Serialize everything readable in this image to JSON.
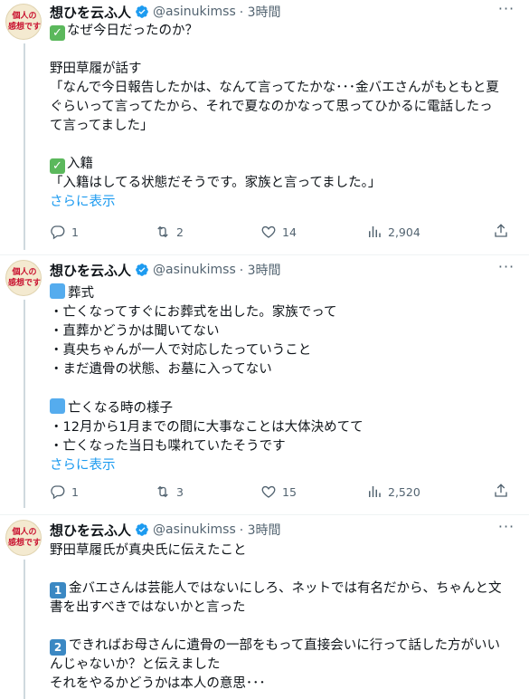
{
  "tweets": [
    {
      "avatar_text": [
        "個人の",
        "感想です"
      ],
      "name": "想ひを云ふ人",
      "handle": "@asinukimss",
      "time": "· 3時間",
      "lines": [
        {
          "prefix": "check",
          "text": "なぜ今日だったのか？"
        },
        {
          "text": ""
        },
        {
          "text": "野田草履が話す"
        },
        {
          "text": "「なんで今日報告したかは、なんて言ってたかな･･･金バエさんがもともと夏"
        },
        {
          "text": "ぐらいって言ってたから、それで夏なのかなって思ってひかるに電話したっ"
        },
        {
          "text": "て言ってました」"
        },
        {
          "text": ""
        },
        {
          "prefix": "check",
          "text": "入籍"
        },
        {
          "text": "「入籍はしてる状態だそうです。家族と言ってました。」"
        }
      ],
      "show_more": "さらに表示",
      "replies": "1",
      "retweets": "2",
      "likes": "14",
      "views": "2,904"
    },
    {
      "avatar_text": [
        "個人の",
        "感想です"
      ],
      "name": "想ひを云ふ人",
      "handle": "@asinukimss",
      "time": "· 3時間",
      "lines": [
        {
          "prefix": "blue",
          "text": "葬式"
        },
        {
          "text": "・亡くなってすぐにお葬式を出した。家族でって"
        },
        {
          "text": "・直葬かどうかは聞いてない"
        },
        {
          "text": "・真央ちゃんが一人で対応したっていうこと"
        },
        {
          "text": "・まだ遺骨の状態、お墓に入ってない"
        },
        {
          "text": ""
        },
        {
          "prefix": "blue",
          "text": "亡くなる時の様子"
        },
        {
          "text": "・12月から1月までの間に大事なことは大体決めてて"
        },
        {
          "text": "・亡くなった当日も喋れていたそうです"
        }
      ],
      "show_more": "さらに表示",
      "replies": "1",
      "retweets": "3",
      "likes": "15",
      "views": "2,520"
    },
    {
      "avatar_text": [
        "個人の",
        "感想です"
      ],
      "name": "想ひを云ふ人",
      "handle": "@asinukimss",
      "time": "· 3時間",
      "lines": [
        {
          "text": "野田草履氏が真央氏に伝えたこと"
        },
        {
          "text": ""
        },
        {
          "prefix": "1",
          "text": "金バエさんは芸能人ではないにしろ、ネットでは有名だから、ちゃんと文"
        },
        {
          "text": "書を出すべきではないかと言った"
        },
        {
          "text": ""
        },
        {
          "prefix": "2",
          "text": "できればお母さんに遺骨の一部をもって直接会いに行って話した方がいい"
        },
        {
          "text": "んじゃないか？と伝えました"
        },
        {
          "text": "それをやるかどうかは本人の意思･･･"
        }
      ]
    }
  ],
  "colors": {
    "accent": "#1d9bf0",
    "muted": "#536471",
    "verified": "#1d9bf0",
    "check_green": "#5bb85c",
    "blue_square": "#55acee",
    "keycap_blue": "#3b88c3"
  }
}
